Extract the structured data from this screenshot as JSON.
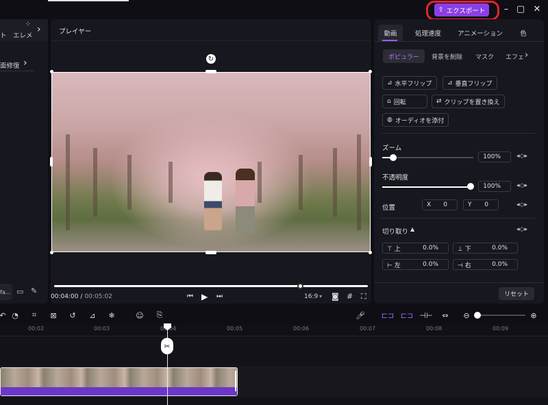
{
  "top": {
    "export_label": "エクスポート"
  },
  "left": {
    "tab_edge_left": "ト",
    "tab_elements": "エレメ",
    "repair_item": "面修復",
    "bottom_pill": "fa..."
  },
  "player": {
    "title": "プレイヤー",
    "time_current": "00:04:00",
    "time_sep": "/",
    "time_total": "00:05:02",
    "aspect": "16:9"
  },
  "right": {
    "tabs": [
      "動画",
      "処理速度",
      "アニメーション",
      "色"
    ],
    "subtabs": [
      "ポピュラー",
      "背景を削除",
      "マスク",
      "エフェ"
    ],
    "buttons": {
      "h_flip": "水平フリップ",
      "v_flip": "垂直フリップ",
      "rotate": "回転",
      "replace": "クリップを置き換え",
      "add_audio": "オーディオを添付"
    },
    "zoom": {
      "label": "ズーム",
      "value": "100%",
      "level": 0.12
    },
    "opacity": {
      "label": "不透明度",
      "value": "100%",
      "level": 1.0
    },
    "position": {
      "label": "位置",
      "x_label": "X",
      "x_value": "0",
      "y_label": "Y",
      "y_value": "0"
    },
    "crop": {
      "label": "切り取り",
      "top_label": "上",
      "top_value": "0.0%",
      "bottom_label": "下",
      "bottom_value": "0.0%",
      "left_label": "左",
      "left_value": "0.0%",
      "right_label": "右",
      "right_value": "0.0%"
    },
    "reset": "リセット"
  },
  "timeline": {
    "ticks": [
      "00:02",
      "00:03",
      "00:04",
      "00:05",
      "00:06",
      "00:07",
      "00:08",
      "00:09"
    ]
  }
}
